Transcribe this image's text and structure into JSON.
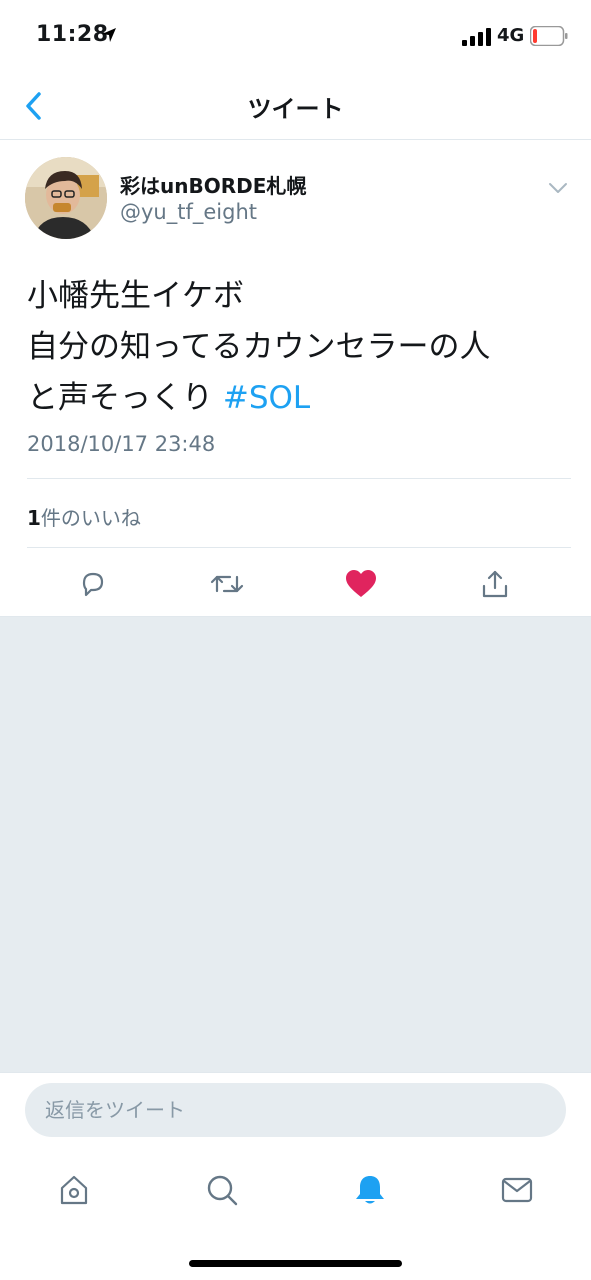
{
  "status_bar": {
    "time": "11:28",
    "network": "4G",
    "icons": [
      "location-arrow-icon",
      "signal-icon",
      "battery-icon"
    ],
    "battery_color": "#ff3b30"
  },
  "nav": {
    "title": "ツイート",
    "back_icon": "chevron-left-icon"
  },
  "tweet": {
    "author_name": "彩はunBORDE札幌",
    "author_handle": "@yu_tf_eight",
    "text_lines": [
      "小幡先生イケボ",
      "自分の知ってるカウンセラーの人",
      "と声そっくり"
    ],
    "hashtag": "#SOL",
    "timestamp": "2018/10/17 23:48",
    "likes_count": "1",
    "likes_label": "件のいいね",
    "actions": [
      "reply-icon",
      "retweet-icon",
      "heart-icon",
      "share-icon"
    ]
  },
  "reply": {
    "placeholder": "返信をツイート"
  },
  "tab_bar": {
    "tabs": [
      "home-icon",
      "search-icon",
      "notifications-icon",
      "messages-icon"
    ],
    "active": "notifications-icon"
  },
  "colors": {
    "accent": "#1da1f2",
    "like": "#e0245e",
    "muted": "#657786",
    "background_gray": "#e6ecf0"
  }
}
